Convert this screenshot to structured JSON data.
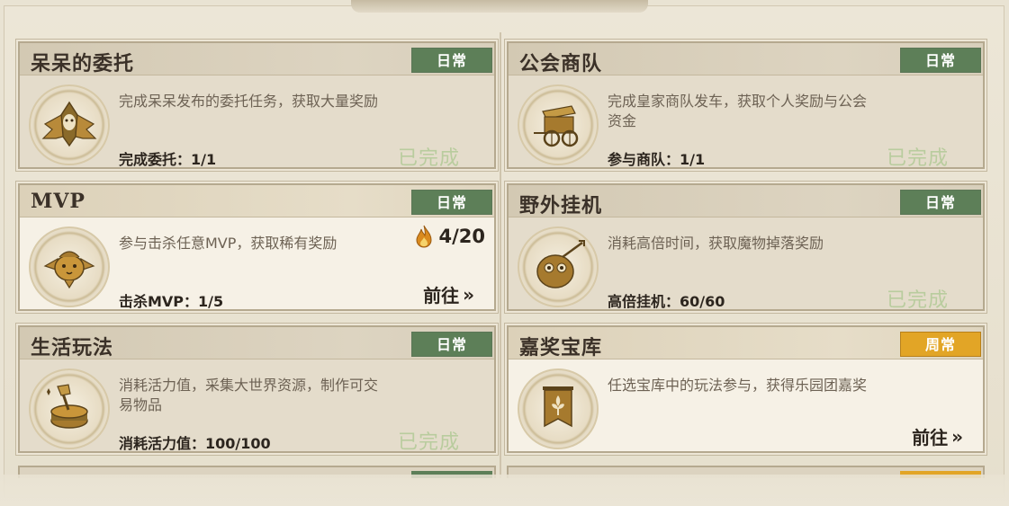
{
  "colors": {
    "daily_badge": "#5d7f58",
    "weekly_badge": "#e2a526",
    "done_text": "#b9cc9e"
  },
  "cards": [
    {
      "title": "呆呆的委托",
      "badge": "日常",
      "badge_type": "daily",
      "icon": "winged-mask-icon",
      "desc": "完成呆呆发布的委托任务，获取大量奖励",
      "progress": "完成委托：1/1",
      "status": "已完成"
    },
    {
      "title": "公会商队",
      "badge": "日常",
      "badge_type": "daily",
      "icon": "caravan-wagon-icon",
      "desc": "完成皇家商队发车，获取个人奖励与公会资金",
      "progress": "参与商队：1/1",
      "status": "已完成"
    },
    {
      "title": "MVP",
      "badge": "日常",
      "badge_type": "daily",
      "icon": "mvp-bird-icon",
      "desc": "参与击杀任意MVP，获取稀有奖励",
      "progress": "击杀MVP：1/5",
      "reward": "4/20",
      "action": "前往"
    },
    {
      "title": "野外挂机",
      "badge": "日常",
      "badge_type": "daily",
      "icon": "monster-drop-icon",
      "desc": "消耗高倍时间，获取魔物掉落奖励",
      "progress": "高倍挂机：60/60",
      "status": "已完成"
    },
    {
      "title": "生活玩法",
      "badge": "日常",
      "badge_type": "daily",
      "icon": "axe-stump-icon",
      "desc": "消耗活力值，采集大世界资源，制作可交易物品",
      "progress": "消耗活力值：100/100",
      "status": "已完成"
    },
    {
      "title": "嘉奖宝库",
      "badge": "周常",
      "badge_type": "weekly",
      "icon": "banner-fleur-icon",
      "desc": "任选宝库中的玩法参与，获得乐园团嘉奖",
      "progress": "",
      "action": "前往"
    }
  ]
}
